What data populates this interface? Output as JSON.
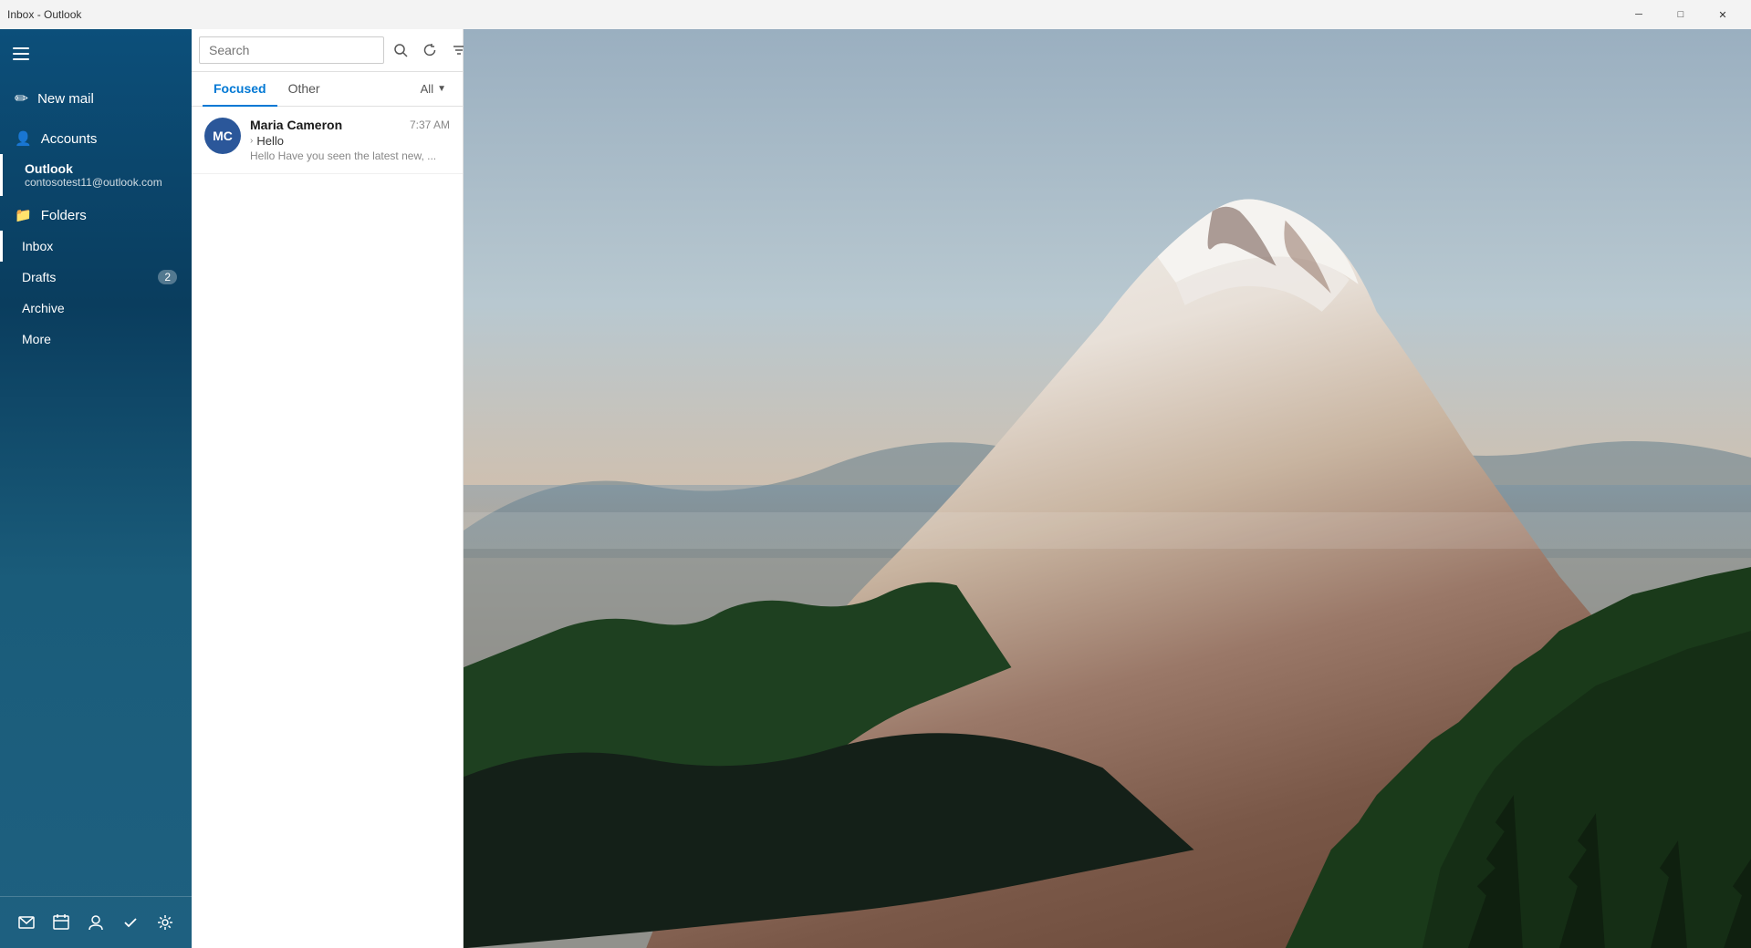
{
  "titleBar": {
    "title": "Inbox - Outlook",
    "minimizeLabel": "─",
    "maximizeLabel": "□",
    "closeLabel": "✕"
  },
  "sidebar": {
    "hamburgerLabel": "Menu",
    "newMailLabel": "New mail",
    "accountsLabel": "Accounts",
    "account": {
      "name": "Outlook",
      "email": "contosotest11@outlook.com"
    },
    "foldersLabel": "Folders",
    "folders": [
      {
        "name": "Inbox",
        "badge": "",
        "active": true
      },
      {
        "name": "Drafts",
        "badge": "2",
        "active": false
      },
      {
        "name": "Archive",
        "badge": "",
        "active": false
      },
      {
        "name": "More",
        "badge": "",
        "active": false
      }
    ],
    "footer": {
      "mailIcon": "✉",
      "calendarIcon": "▦",
      "peopleIcon": "👤",
      "tasksIcon": "✓",
      "settingsIcon": "⚙"
    }
  },
  "mailList": {
    "searchPlaceholder": "Search",
    "tabs": [
      {
        "label": "Focused",
        "active": true
      },
      {
        "label": "Other",
        "active": false
      }
    ],
    "filterLabel": "All",
    "emails": [
      {
        "senderInitials": "MC",
        "senderName": "Maria Cameron",
        "time": "7:37 AM",
        "subject": "Hello",
        "preview": "Hello Have you seen the latest new, ..."
      }
    ]
  }
}
